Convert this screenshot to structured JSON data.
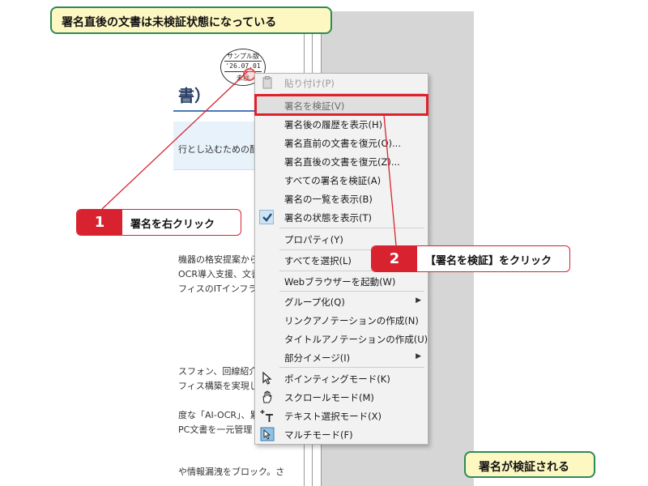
{
  "callouts": {
    "top_note": "署名直後の文書は未検証状態になっている",
    "bottom_note": "署名が検証される",
    "step1": {
      "number": "1",
      "text": "署名を右クリック"
    },
    "step2": {
      "number": "2",
      "text": "【署名を検証】をクリック"
    }
  },
  "stamp": {
    "line1": "サンプル版",
    "line2": "'26.07.01",
    "line3": "未検"
  },
  "document": {
    "heading": "書）",
    "band_text": "行とし込むための配置・",
    "lines": [
      "機器の格安提案から、ビ",
      "OCR導入支援、文書管理",
      "フィスのITインフラを",
      "スフォン、回線紹介が丸",
      "フィス構築を実現しま",
      "度な「AI-OCR」、累計",
      "PC文書を一元管理し、",
      "や情報漏洩をブロック。さ"
    ]
  },
  "context_menu": {
    "items": [
      {
        "label": "貼り付け(P)",
        "icon": "clipboard-icon",
        "disabled": true
      },
      {
        "label": "署名を検証(V)",
        "highlighted": true
      },
      {
        "label": "署名後の履歴を表示(H)"
      },
      {
        "label": "署名直前の文書を復元(O)..."
      },
      {
        "label": "署名直後の文書を復元(Z)..."
      },
      {
        "label": "すべての署名を検証(A)"
      },
      {
        "label": "署名の一覧を表示(B)"
      },
      {
        "label": "署名の状態を表示(T)",
        "icon": "check-icon",
        "checked": true
      },
      {
        "label": "プロパティ(Y)"
      },
      {
        "label": "すべてを選択(L)"
      },
      {
        "label": "Webブラウザーを起動(W)"
      },
      {
        "label": "グループ化(Q)",
        "submenu": true
      },
      {
        "label": "リンクアノテーションの作成(N)"
      },
      {
        "label": "タイトルアノテーションの作成(U)"
      },
      {
        "label": "部分イメージ(I)",
        "submenu": true
      },
      {
        "label": "ポインティングモード(K)",
        "icon": "pointer-arrow-icon"
      },
      {
        "label": "スクロールモード(M)",
        "icon": "hand-icon"
      },
      {
        "label": "テキスト選択モード(X)",
        "icon": "text-select-icon"
      },
      {
        "label": "マルチモード(F)",
        "icon": "multi-mode-icon"
      }
    ],
    "submenu_arrow": "▶"
  },
  "colors": {
    "accent_red": "#d82230",
    "note_border": "#2e8a56",
    "note_fill": "#fdf7c2"
  }
}
